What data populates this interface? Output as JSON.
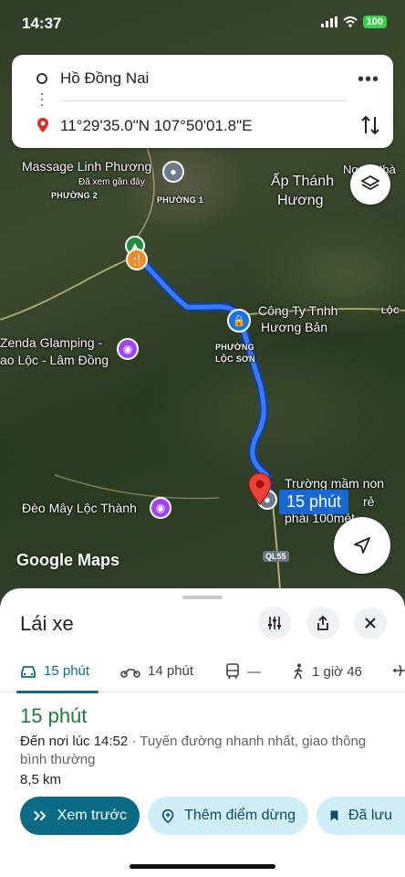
{
  "status_bar": {
    "time": "14:37",
    "battery": "100"
  },
  "search": {
    "origin": "Hồ Đồng Nai",
    "destination": "11°29'35.0\"N 107°50'01.8\"E",
    "more_icon": "more-horizontal-icon",
    "swap_icon": "swap-vertical-icon"
  },
  "map": {
    "labels": {
      "massage": "Massage Linh Phương",
      "recent": "Đã xem gần đây",
      "phuong2": "PHƯỜNG 2",
      "phuong1": "PHƯỜNG 1",
      "ap_thanh_huong_1": "Ấp Thánh",
      "ap_thanh_huong_2": "Hương",
      "ngoc_nha": "Ngọc Nhà",
      "company_1": "Công Ty Tnhh",
      "company_2": "Hương Bản",
      "loc": "LỘC",
      "phuong_loc_son_1": "PHƯỜNG",
      "phuong_loc_son_2": "LỘC SƠN",
      "zenda_1": "Zenda Glamping -",
      "zenda_2": "ao Lộc - Lâm Đồng",
      "deo_may": "Đèo Mây Lộc Thành",
      "school_1": "Trường mầm non",
      "school_2": "rẻ",
      "school_3": "phải 100mét"
    },
    "eta_bubble": "15 phút",
    "logo": "Google Maps",
    "road_shield": "QL55",
    "route_color": "#1a56f0"
  },
  "sheet": {
    "title": "Lái xe",
    "tabs": [
      {
        "icon": "car-icon",
        "label": "15 phút"
      },
      {
        "icon": "motorbike-icon",
        "label": "14 phút"
      },
      {
        "icon": "transit-icon",
        "label": "—"
      },
      {
        "icon": "walk-icon",
        "label": "1 giờ 46"
      }
    ],
    "route_time": "15 phút",
    "arrival": "Đến nơi lúc 14:52",
    "description": " · Tuyến đường nhanh nhất, giao thông bình thường",
    "distance": "8,5 km",
    "buttons": {
      "preview": "Xem trước",
      "add_stop": "Thêm điểm dừng",
      "saved": "Đã lưu"
    }
  },
  "colors": {
    "accent": "#0b6a84",
    "eta_green": "#188038",
    "route_blue": "#1a56f0"
  }
}
